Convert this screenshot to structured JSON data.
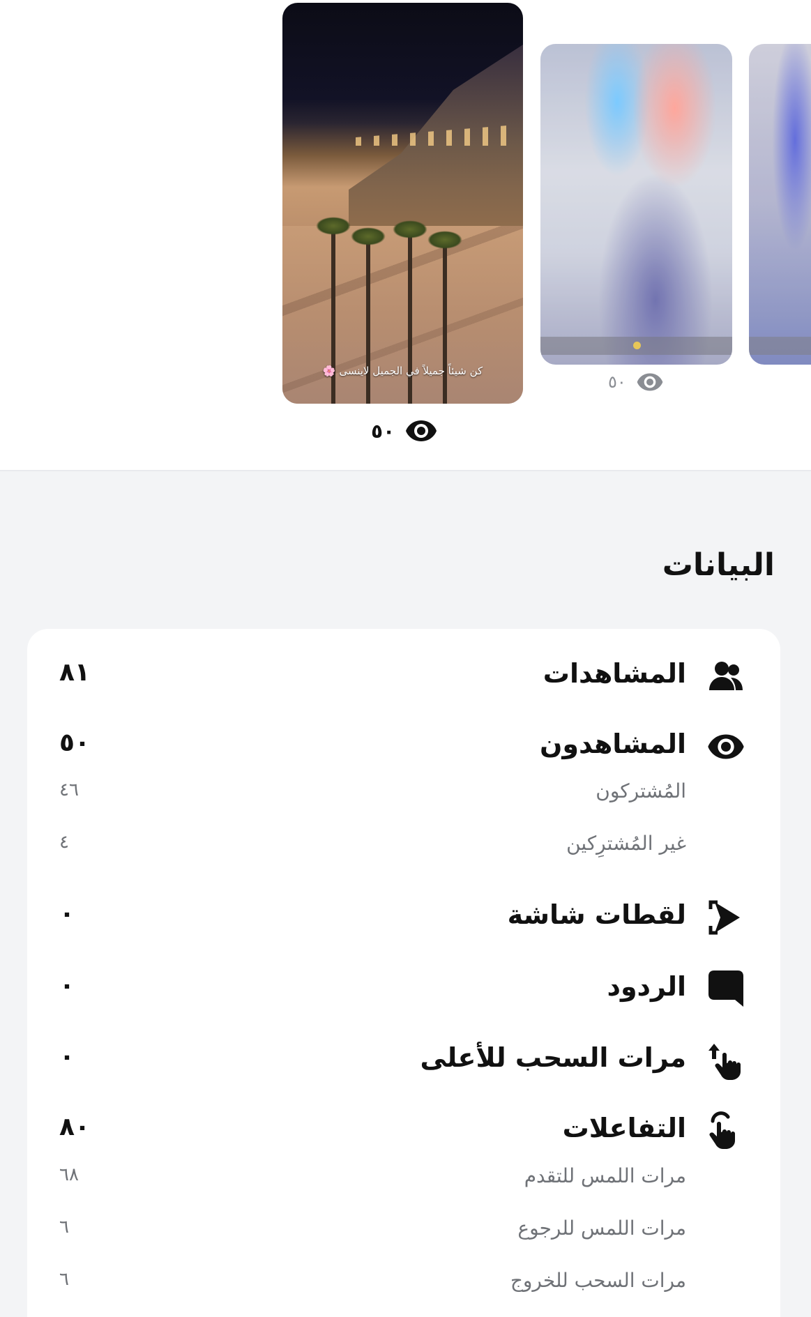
{
  "stories": {
    "main": {
      "views": "٥٠",
      "caption": "كن شيئاً جميلاً في الجميل لاينسى 🌸"
    },
    "mid": {
      "views": "٥٠"
    }
  },
  "section": {
    "title": "البيانات"
  },
  "stats": [
    {
      "icon": "two-users-icon",
      "label": "المشاهدات",
      "value": "٨١",
      "sub": false
    },
    {
      "icon": "eye-icon",
      "label": "المشاهدون",
      "value": "٥٠",
      "sub": false
    },
    {
      "icon": "",
      "label": "المُشتركون",
      "value": "٤٦",
      "sub": true
    },
    {
      "icon": "",
      "label": "غير المُشترِكين",
      "value": "٤",
      "sub": true
    },
    {
      "icon": "screenshot-icon",
      "label": "لقطات شاشة",
      "value": "٠",
      "sub": false
    },
    {
      "icon": "chat-bubble-icon",
      "label": "الردود",
      "value": "٠",
      "sub": false
    },
    {
      "icon": "swipe-up-icon",
      "label": "مرات السحب للأعلى",
      "value": "٠",
      "sub": false
    },
    {
      "icon": "tap-icon",
      "label": "التفاعلات",
      "value": "٨٠",
      "sub": false
    },
    {
      "icon": "",
      "label": "مرات اللمس للتقدم",
      "value": "٦٨",
      "sub": true
    },
    {
      "icon": "",
      "label": "مرات اللمس للرجوع",
      "value": "٦",
      "sub": true
    },
    {
      "icon": "",
      "label": "مرات السحب للخروج",
      "value": "٦",
      "sub": true
    }
  ],
  "colors": {
    "background": "#f3f4f6",
    "card": "#ffffff",
    "text": "#111111",
    "muted": "#6f7277"
  }
}
